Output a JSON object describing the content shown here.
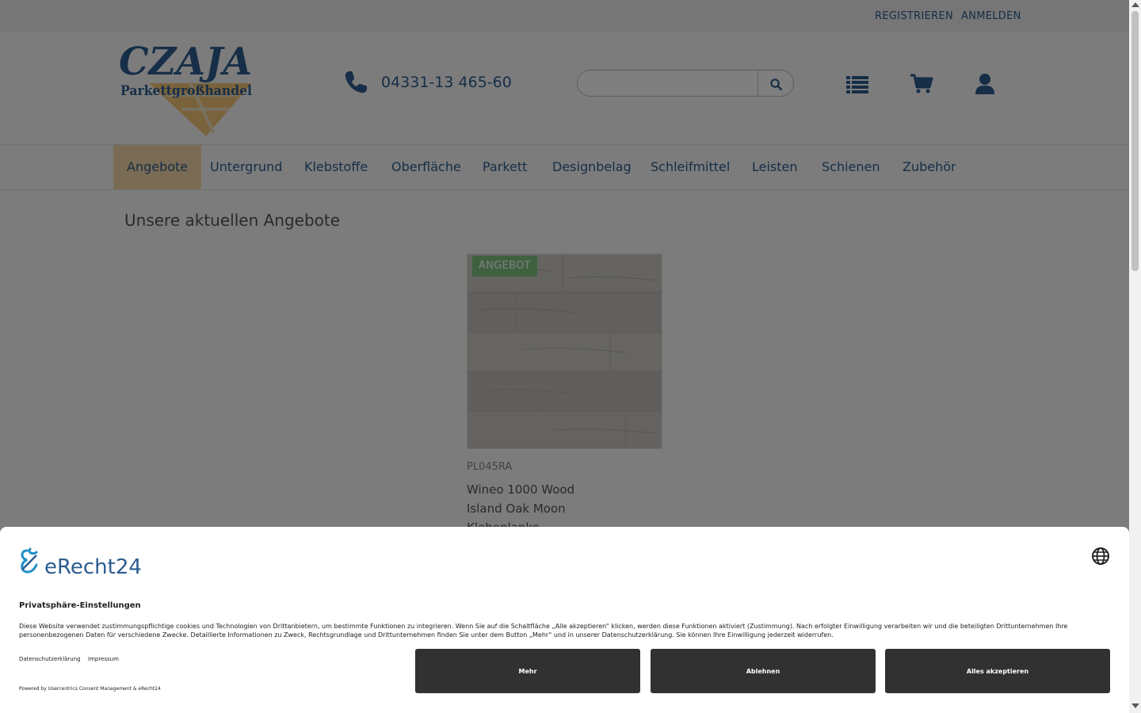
{
  "topbar": {
    "register": "REGISTRIEREN",
    "login": "ANMELDEN"
  },
  "header": {
    "logo_text": "CZAJA",
    "logo_subtext": "Parkettgroßhandel",
    "phone": "04331-13 465-60",
    "search": {
      "placeholder": "",
      "icon": "search-icon"
    },
    "icons": [
      "list-icon",
      "cart-icon",
      "user-icon"
    ]
  },
  "nav": {
    "items": [
      {
        "label": "Angebote",
        "active": true
      },
      {
        "label": "Untergrund"
      },
      {
        "label": "Klebstoffe"
      },
      {
        "label": "Oberfläche"
      },
      {
        "label": "Parkett"
      },
      {
        "label": "Designbelag"
      },
      {
        "label": "Schleifmittel"
      },
      {
        "label": "Leisten"
      },
      {
        "label": "Schienen"
      },
      {
        "label": "Zubehör"
      }
    ]
  },
  "main": {
    "heading": "Unsere aktuellen Angebote",
    "product": {
      "badge": "ANGEBOT",
      "sku": "PL045RA",
      "name_line1": "Wineo 1000 Wood",
      "name_line2": "Island Oak Moon",
      "name_line3": "Klebeplanke"
    }
  },
  "cookie": {
    "logo_text": "eRecht24",
    "title": "Privatsphäre-Einstellungen",
    "text": "Diese Website verwendet zustimmungspflichtige cookies und Technologien von Drittanbietern, um bestimmte Funktionen zu integrieren. Wenn Sie auf die Schaltfläche „Alle akzeptieren“ klicken, werden diese Funktionen aktiviert (Zustimmung). Nach erfolgter Einwilligung verarbeiten wir und die beteiligten Drittunternehmen Ihre personenbezogenen Daten für verschiedene Zwecke. Detaillierte Informationen zu Zweck, Rechtsgrundlage und Drittunternehmen finden Sie unter dem Button „Mehr“ und in unserer Datenschutzerklärung. Sie können Ihre Einwilligung jederzeit widerrufen.",
    "link_privacy": "Datenschutzerklärung",
    "link_imprint": "Impressum",
    "btn_more": "Mehr",
    "btn_decline": "Ablehnen",
    "btn_accept": "Alles akzeptieren",
    "powered": "Powered by Usercentrics Consent Management & eRecht24"
  },
  "colors": {
    "brand_blue": "#2c5d8f",
    "logo_orange": "#f5c678",
    "nav_active_bg": "#f5d9a8",
    "badge_green": "#7ec27e",
    "button_dark": "#313131"
  }
}
